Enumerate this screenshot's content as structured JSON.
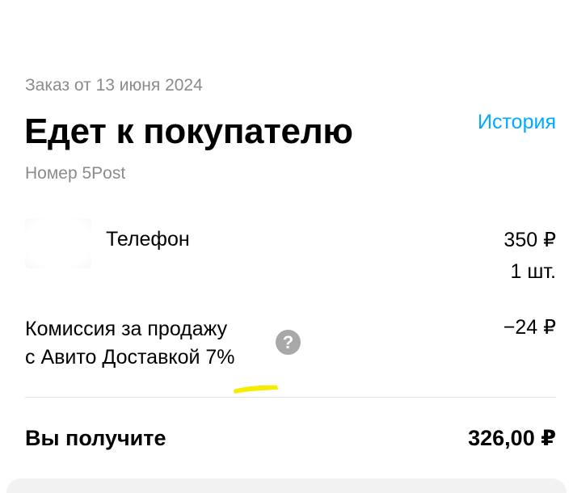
{
  "order": {
    "date_label": "Заказ от 13 июня 2024",
    "status": "Едет к покупателю",
    "tracking_label": "Номер 5Post"
  },
  "header": {
    "history_link": "История"
  },
  "item": {
    "title": "Телефон",
    "price": "350 ₽",
    "quantity": "1 шт."
  },
  "commission": {
    "label_line1": "Комиссия за продажу",
    "label_line2": "с Авито Доставкой 7%",
    "amount": "−24 ₽",
    "help_icon": "question-circle-icon",
    "help_glyph": "?"
  },
  "total": {
    "label": "Вы получите",
    "amount": "326,00 ₽"
  },
  "colors": {
    "link": "#00aaff",
    "muted_text": "#8b8b8b",
    "help_icon_bg": "#a8a8a8",
    "highlight_mark": "#f5ec00",
    "divider": "#e3e3e3"
  }
}
